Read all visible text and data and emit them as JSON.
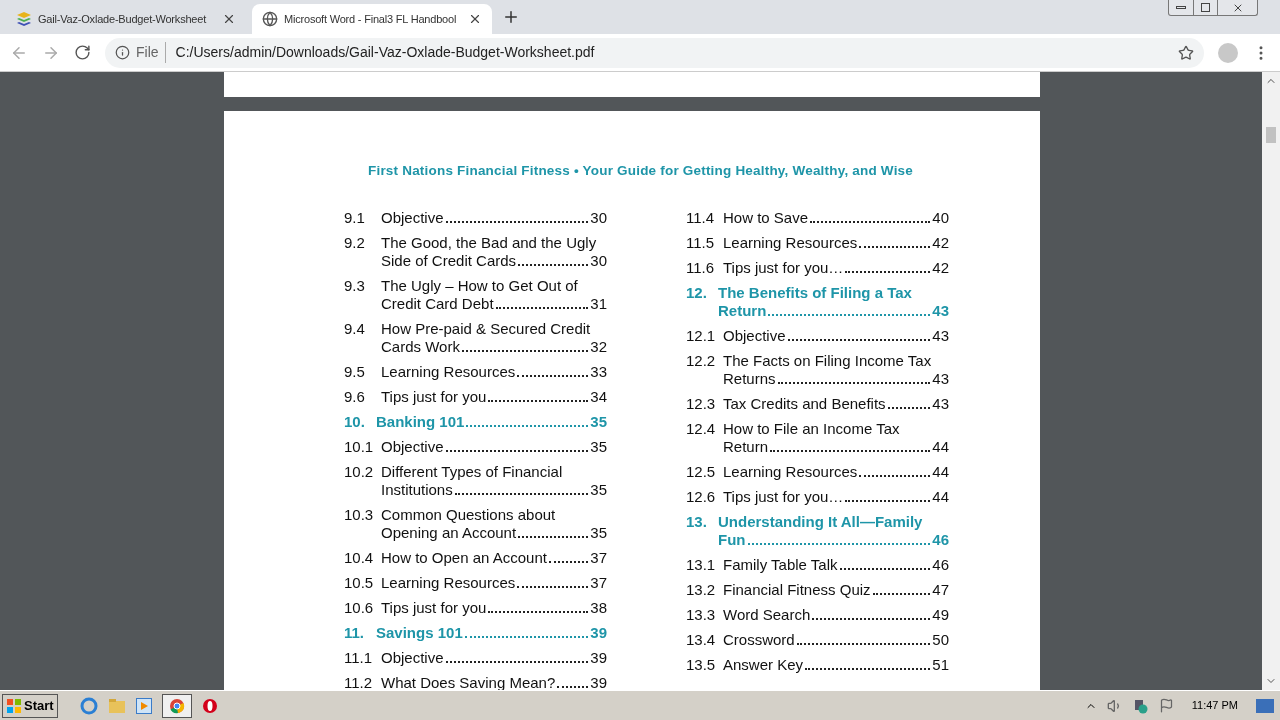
{
  "browser": {
    "tabs": [
      {
        "title": "Gail-Vaz-Oxlade-Budget-Worksheet",
        "selected": false
      },
      {
        "title": "Microsoft Word - Final3 FL Handbool",
        "selected": true
      }
    ],
    "address": {
      "scheme": "File",
      "url": "C:/Users/admin/Downloads/Gail-Vaz-Oxlade-Budget-Worksheet.pdf"
    }
  },
  "document": {
    "running_header": "First Nations Financial Fitness • Your Guide for Getting Healthy, Wealthy, and Wise",
    "columns": [
      [
        {
          "kind": "section",
          "number": "9.1",
          "lines": [
            "Objective"
          ],
          "page": "30"
        },
        {
          "kind": "section",
          "number": "9.2",
          "lines": [
            "The Good, the Bad and the Ugly",
            "Side of Credit Cards"
          ],
          "page": "30"
        },
        {
          "kind": "section",
          "number": "9.3",
          "lines": [
            "The Ugly – How to Get Out of",
            "Credit Card Debt"
          ],
          "page": "31"
        },
        {
          "kind": "section",
          "number": "9.4",
          "lines": [
            "How Pre-paid & Secured Credit",
            "Cards Work"
          ],
          "page": "32"
        },
        {
          "kind": "section",
          "number": "9.5",
          "lines": [
            "Learning Resources"
          ],
          "page": "33"
        },
        {
          "kind": "section",
          "number": "9.6",
          "lines": [
            "Tips just for you"
          ],
          "page": "34"
        },
        {
          "kind": "chapter",
          "number": "10.",
          "lines": [
            "Banking 101"
          ],
          "page": "35"
        },
        {
          "kind": "section",
          "number": "10.1",
          "lines": [
            "Objective"
          ],
          "page": "35"
        },
        {
          "kind": "section",
          "number": "10.2",
          "lines": [
            "Different Types of Financial",
            "Institutions"
          ],
          "page": "35"
        },
        {
          "kind": "section",
          "number": "10.3",
          "lines": [
            "Common Questions about",
            "Opening an Account"
          ],
          "page": "35"
        },
        {
          "kind": "section",
          "number": "10.4",
          "lines": [
            "How to Open an Account"
          ],
          "page": "37"
        },
        {
          "kind": "section",
          "number": "10.5",
          "lines": [
            "Learning Resources"
          ],
          "page": "37"
        },
        {
          "kind": "section",
          "number": "10.6",
          "lines": [
            "Tips just for you"
          ],
          "page": "38"
        },
        {
          "kind": "chapter",
          "number": "11.",
          "lines": [
            "Savings 101"
          ],
          "page": "39"
        },
        {
          "kind": "section",
          "number": "11.1",
          "lines": [
            "Objective"
          ],
          "page": "39"
        },
        {
          "kind": "section",
          "number": "11.2",
          "lines": [
            "What Does Saving Mean?"
          ],
          "page": "39"
        }
      ],
      [
        {
          "kind": "section",
          "number": "11.4",
          "lines": [
            "How to Save"
          ],
          "page": "40"
        },
        {
          "kind": "section",
          "number": "11.5",
          "lines": [
            "Learning Resources"
          ],
          "page": "42"
        },
        {
          "kind": "section",
          "number": "11.6",
          "lines": [
            "Tips just for you…"
          ],
          "page": "42"
        },
        {
          "kind": "chapter",
          "number": "12.",
          "lines": [
            "The Benefits of Filing a Tax",
            "Return"
          ],
          "page": "43"
        },
        {
          "kind": "section",
          "number": "12.1",
          "lines": [
            "Objective"
          ],
          "page": "43"
        },
        {
          "kind": "section",
          "number": "12.2",
          "lines": [
            "The Facts on Filing Income Tax",
            "Returns"
          ],
          "page": "43"
        },
        {
          "kind": "section",
          "number": "12.3",
          "lines": [
            "Tax Credits and Benefits"
          ],
          "page": "43"
        },
        {
          "kind": "section",
          "number": "12.4",
          "lines": [
            "How to File an Income Tax",
            "Return"
          ],
          "page": "44"
        },
        {
          "kind": "section",
          "number": "12.5",
          "lines": [
            "Learning Resources"
          ],
          "page": "44"
        },
        {
          "kind": "section",
          "number": "12.6",
          "lines": [
            "Tips just for you…"
          ],
          "page": "44"
        },
        {
          "kind": "chapter",
          "number": "13.",
          "lines": [
            "Understanding It All—Family",
            "Fun"
          ],
          "page": "46"
        },
        {
          "kind": "section",
          "number": "13.1",
          "lines": [
            "Family Table Talk"
          ],
          "page": "46"
        },
        {
          "kind": "section",
          "number": "13.2",
          "lines": [
            "Financial Fitness Quiz"
          ],
          "page": "47"
        },
        {
          "kind": "section",
          "number": "13.3",
          "lines": [
            "Word Search"
          ],
          "page": "49"
        },
        {
          "kind": "section",
          "number": "13.4",
          "lines": [
            "Crossword"
          ],
          "page": "50"
        },
        {
          "kind": "section",
          "number": "13.5",
          "lines": [
            "Answer Key"
          ],
          "page": "51"
        }
      ]
    ]
  },
  "taskbar": {
    "start": "Start",
    "clock": "11:47 PM"
  }
}
